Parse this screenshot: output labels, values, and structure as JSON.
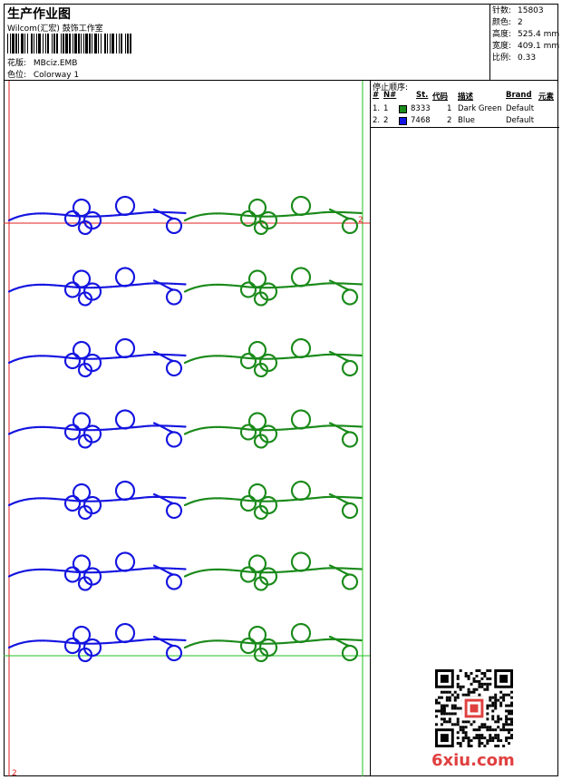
{
  "header": {
    "title": "生产作业图",
    "subtitle": "Wilcom(汇宏) 鼓饰工作室",
    "pattern_label": "花版:",
    "pattern_value": "MBciz.EMB",
    "color_label": "色位:",
    "color_value": "Colorway 1"
  },
  "stats": [
    {
      "label": "针数:",
      "value": "15803"
    },
    {
      "label": "颜色:",
      "value": "2"
    },
    {
      "label": "高度:",
      "value": "525.4 mm"
    },
    {
      "label": "宽度:",
      "value": "409.1 mm"
    },
    {
      "label": "比例:",
      "value": "0.33"
    }
  ],
  "stop_order": {
    "title": "停止顺序:",
    "columns": [
      "#",
      "N#",
      "St.",
      "代码",
      "描述",
      "Brand",
      "元素"
    ],
    "rows": [
      {
        "num": "1.",
        "n": "1",
        "color": "#1a8a1a",
        "st": "8333",
        "code": "1",
        "desc": "Dark Green",
        "brand": "Default"
      },
      {
        "num": "2.",
        "n": "2",
        "color": "#1414e0",
        "st": "7468",
        "code": "2",
        "desc": "Blue",
        "brand": "Default"
      }
    ]
  },
  "design": {
    "start_marker": "2",
    "end_marker": "2",
    "rows": 7,
    "colors": {
      "left": "#1414e0",
      "right": "#1a8a1a",
      "hline_top": "#e02020",
      "vline_left": "#e02020",
      "guide": "#22c022"
    }
  },
  "watermark": "6xiu.com"
}
